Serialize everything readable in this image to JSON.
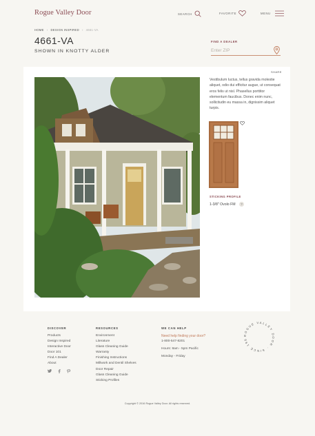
{
  "header": {
    "logo": "Rogue Valley Door",
    "search_label": "SEARCH",
    "favorite_label": "FAVORITE",
    "menu_label": "MENU"
  },
  "breadcrumb": [
    "HOME",
    "DESIGN INSPIRED",
    "4661-VA"
  ],
  "product": {
    "title": "4661-VA",
    "subtitle": "SHOWN IN KNOTTY ALDER",
    "share_label": "SHARE",
    "description": "Vestibulum luctus, tellus gravida molestie aliquet, odio dui efficitur augue, ut consequat eros felis ut nisl. Phasellus porttitor elementum faucibus. Donec enim nunc, sollicitudin eu massa in, dignissim aliquet turpis.",
    "sticking_label": "STICKING PROFILE",
    "sticking_value": "1-3/8\" Ovolo FM",
    "help_glyph": "?"
  },
  "dealer": {
    "label": "FIND A DEALER",
    "zip_placeholder": "Enter ZIP"
  },
  "footer": {
    "discover": {
      "heading": "DISCOVER",
      "items": [
        "Products",
        "Design Inspired",
        "Interactive Door",
        "Door 101",
        "Find A Dealer",
        "About"
      ]
    },
    "resources": {
      "heading": "RESOURCES",
      "items": [
        "Environment",
        "Literature",
        "Glass Cleaning Guide",
        "Warranty",
        "Finishing Instructions",
        "Millwork and Dentil Shelves",
        "Door Repair",
        "Glass Cleaning Guide",
        "Sticking Profiles"
      ]
    },
    "help": {
      "heading": "WE CAN HELP",
      "link": "Need help finding your door?",
      "phone": "1-800-547-8201",
      "hours": "Hours: 8am - 5pm Pacific",
      "days": "Monday - Friday"
    },
    "seal_text": "ROGUE VALLEY DOOR · SINCE 1981 ·",
    "copyright": "Copyright © 2016 Rogue Valley Door. All rights reserved."
  },
  "icons": {
    "social": [
      "twitter-icon",
      "facebook-icon",
      "pinterest-icon"
    ]
  },
  "colors": {
    "brand": "#8a4a52",
    "accent": "#c07a5a",
    "background": "#f7f6f2"
  }
}
